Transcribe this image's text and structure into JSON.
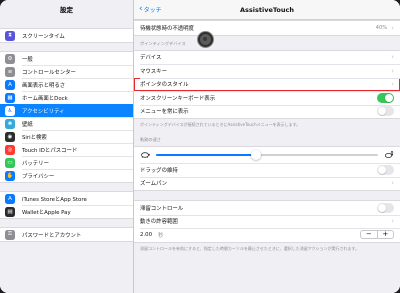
{
  "sidebar": {
    "title": "設定",
    "groups": [
      [
        {
          "label": "スクリーンタイム",
          "icon": "hourglass-icon",
          "color": "#5856d6",
          "glyph": "⧗"
        }
      ],
      [
        {
          "label": "一般",
          "icon": "gear-icon",
          "color": "#8e8e93",
          "glyph": "⚙"
        },
        {
          "label": "コントロールセンター",
          "icon": "control-center-icon",
          "color": "#8e8e93",
          "glyph": "≡"
        },
        {
          "label": "画面表示と明るさ",
          "icon": "brightness-icon",
          "color": "#0a7aff",
          "glyph": "A"
        },
        {
          "label": "ホーム画面とDock",
          "icon": "home-grid-icon",
          "color": "#0a7aff",
          "glyph": "▦"
        },
        {
          "label": "アクセシビリティ",
          "icon": "accessibility-icon",
          "color": "#0a7aff",
          "glyph": "♿",
          "active": true
        },
        {
          "label": "壁紙",
          "icon": "wallpaper-icon",
          "color": "#34aadc",
          "glyph": "❀"
        },
        {
          "label": "Siriと検索",
          "icon": "siri-icon",
          "color": "#2c2c2e",
          "glyph": "◉"
        },
        {
          "label": "Touch IDとパスコード",
          "icon": "fingerprint-icon",
          "color": "#ff3b30",
          "glyph": "◎"
        },
        {
          "label": "バッテリー",
          "icon": "battery-icon",
          "color": "#34c759",
          "glyph": "▭"
        },
        {
          "label": "プライバシー",
          "icon": "privacy-hand-icon",
          "color": "#0a7aff",
          "glyph": "✋"
        }
      ],
      [
        {
          "label": "iTunes StoreとApp Store",
          "icon": "app-store-icon",
          "color": "#0a7aff",
          "glyph": "A"
        },
        {
          "label": "WalletとApple Pay",
          "icon": "wallet-icon",
          "color": "#2c2c2e",
          "glyph": "▤"
        }
      ],
      [
        {
          "label": "パスワードとアカウント",
          "icon": "key-icon",
          "color": "#8e8e93",
          "glyph": "⚿"
        }
      ]
    ]
  },
  "nav": {
    "back_label": "タッチ",
    "title": "AssistiveTouch"
  },
  "main": {
    "opacity_row": {
      "label": "待機状態時の不透明度",
      "value": "40%"
    },
    "pointing_header": "ポインティングデバイス",
    "devices_label": "デバイス",
    "mouse_keys_label": "マウスキー",
    "pointer_style_label": "ポインタのスタイル",
    "onscreen_keyboard_label": "オンスクリーンキーボード表示",
    "onscreen_keyboard_on": true,
    "always_show_menu_label": "メニューを常に表示",
    "always_show_menu_on": false,
    "pointing_footer": "ポインティングデバイスが接続されているときにAssistiveTouchメニューを表示します。",
    "tracking_header": "軌跡の速さ",
    "tracking_value": 0.45,
    "slow_icon": "turtle-icon",
    "fast_icon": "rabbit-icon",
    "drag_lock_label": "ドラッグの維持",
    "drag_lock_on": false,
    "zoom_pan_label": "ズームパン",
    "dwell_label": "滞留コントロール",
    "dwell_on": false,
    "tolerance_label": "動きの許容範囲",
    "seconds_value": "2.00",
    "seconds_unit": "秒",
    "stepper_minus": "−",
    "stepper_plus": "+",
    "dwell_footer": "滞留コントロールを有効にすると、指定した時間カーソルを静止させたときに、選択した滞留アクションが実行されます。"
  },
  "colors": {
    "accent": "#0a7aff",
    "switch_on": "#34c759",
    "highlight": "#e8262b"
  }
}
